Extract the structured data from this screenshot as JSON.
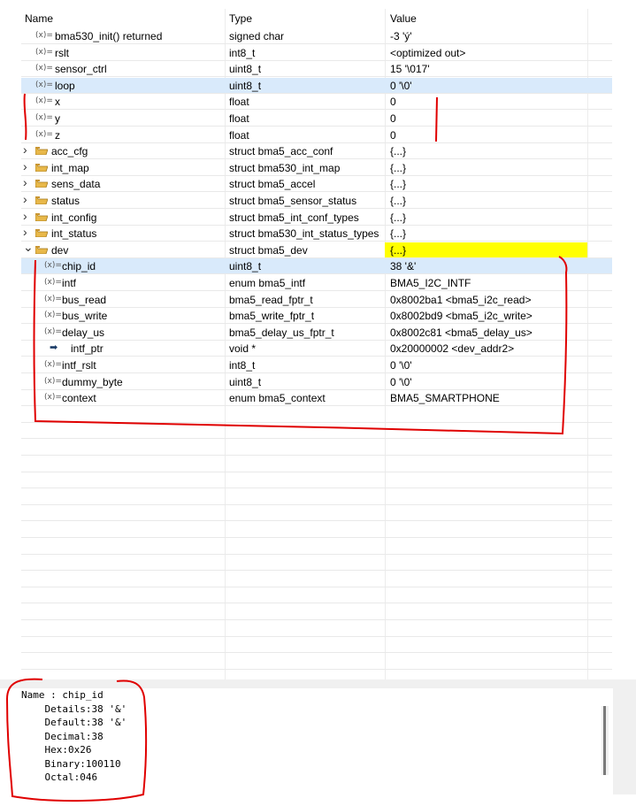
{
  "columns": {
    "name": "Name",
    "type": "Type",
    "value": "Value"
  },
  "rows": [
    {
      "name": "bma530_init() returned",
      "type": "signed char",
      "value": "-3 'ý'",
      "icon": "variable-icon",
      "indent": 0
    },
    {
      "name": "rslt",
      "type": "int8_t",
      "value": "<optimized out>",
      "icon": "variable-icon",
      "indent": 0
    },
    {
      "name": "sensor_ctrl",
      "type": "uint8_t",
      "value": "15 '\\017'",
      "icon": "variable-icon",
      "indent": 0
    },
    {
      "name": "loop",
      "type": "uint8_t",
      "value": "0 '\\0'",
      "icon": "variable-icon",
      "indent": 0,
      "selected": true
    },
    {
      "name": "x",
      "type": "float",
      "value": "0",
      "icon": "variable-icon",
      "indent": 0
    },
    {
      "name": "y",
      "type": "float",
      "value": "0",
      "icon": "variable-icon",
      "indent": 0
    },
    {
      "name": "z",
      "type": "float",
      "value": "0",
      "icon": "variable-icon",
      "indent": 0
    },
    {
      "name": "acc_cfg",
      "type": "struct bma5_acc_conf",
      "value": "{...}",
      "icon": "folder-icon",
      "expander": "collapsed",
      "indent": 0
    },
    {
      "name": "int_map",
      "type": "struct bma530_int_map",
      "value": "{...}",
      "icon": "folder-icon",
      "expander": "collapsed",
      "indent": 0
    },
    {
      "name": "sens_data",
      "type": "struct bma5_accel",
      "value": "{...}",
      "icon": "folder-icon",
      "expander": "collapsed",
      "indent": 0
    },
    {
      "name": "status",
      "type": "struct bma5_sensor_status",
      "value": "{...}",
      "icon": "folder-icon",
      "expander": "collapsed",
      "indent": 0
    },
    {
      "name": "int_config",
      "type": "struct bma5_int_conf_types",
      "value": "{...}",
      "icon": "folder-icon",
      "expander": "collapsed",
      "indent": 0
    },
    {
      "name": "int_status",
      "type": "struct bma530_int_status_types",
      "value": "{...}",
      "icon": "folder-icon",
      "expander": "collapsed",
      "indent": 0
    },
    {
      "name": "dev",
      "type": "struct bma5_dev",
      "value": "{...}",
      "icon": "folder-open-icon",
      "expander": "expanded",
      "indent": 0,
      "highlight": "#ffff00"
    },
    {
      "name": "chip_id",
      "type": "uint8_t",
      "value": "38 '&'",
      "icon": "variable-icon",
      "indent": 1,
      "selected": true
    },
    {
      "name": "intf",
      "type": "enum bma5_intf",
      "value": "BMA5_I2C_INTF",
      "icon": "variable-icon",
      "indent": 1
    },
    {
      "name": "bus_read",
      "type": "bma5_read_fptr_t",
      "value": "0x8002ba1 <bma5_i2c_read>",
      "icon": "variable-icon",
      "indent": 1
    },
    {
      "name": "bus_write",
      "type": "bma5_write_fptr_t",
      "value": "0x8002bd9 <bma5_i2c_write>",
      "icon": "variable-icon",
      "indent": 1
    },
    {
      "name": "delay_us",
      "type": "bma5_delay_us_fptr_t",
      "value": "0x8002c81 <bma5_delay_us>",
      "icon": "variable-icon",
      "indent": 1
    },
    {
      "name": "intf_ptr",
      "type": "void *",
      "value": "0x20000002 <dev_addr2>",
      "icon": "pointer-arrow-icon",
      "indent": 1
    },
    {
      "name": "intf_rslt",
      "type": "int8_t",
      "value": "0 '\\0'",
      "icon": "variable-icon",
      "indent": 1
    },
    {
      "name": "dummy_byte",
      "type": "uint8_t",
      "value": "0 '\\0'",
      "icon": "variable-icon",
      "indent": 1
    },
    {
      "name": "context",
      "type": "enum bma5_context",
      "value": "BMA5_SMARTPHONE",
      "icon": "variable-icon",
      "indent": 1
    }
  ],
  "variable_icon_text": "(x)=",
  "details": {
    "lines": [
      "Name : chip_id",
      "    Details:38 '&'",
      "    Default:38 '&'",
      "    Decimal:38",
      "    Hex:0x26",
      "    Binary:100110",
      "    Octal:046"
    ]
  },
  "colors": {
    "selection": "#d9eafb",
    "highlight": "#ffff00",
    "annotation": "#e00000",
    "folder": "#e8b84a"
  }
}
